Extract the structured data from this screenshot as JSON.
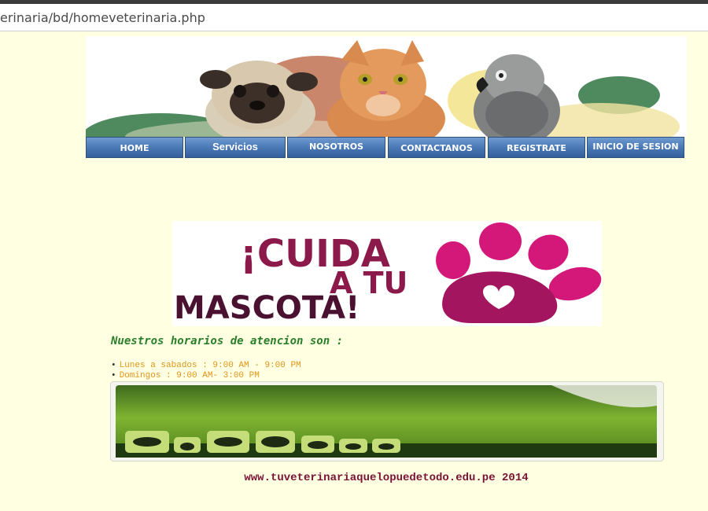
{
  "browser": {
    "url": "erinaria/bd/homeveterinaria.php"
  },
  "nav": {
    "items": [
      {
        "label": "HOME"
      },
      {
        "label": "Servicios"
      },
      {
        "label": "NOSOTROS"
      },
      {
        "label": "CONTACTANOS"
      },
      {
        "label": "REGISTRATE"
      },
      {
        "label": "INICIO DE SESION"
      }
    ]
  },
  "promo": {
    "line1": "¡CUIDA",
    "line2": "A TU",
    "line3": "MASCOTA!"
  },
  "horarios": {
    "title": "Nuestros horarios de atencion son :",
    "items": [
      "Lunes a sabados : 9:00 AM - 9:00 PM",
      "Domingos : 9:00 AM- 3:00 PM"
    ]
  },
  "footer": {
    "text": "www.tuveterinariaquelopuedetodo.edu.pe 2014"
  },
  "colors": {
    "page_bg": "#ffffe1",
    "nav_blue": "#4a79b6",
    "promo_maroon": "#8b1a4a",
    "promo_pink": "#d4187a",
    "horarios_title": "#2a7f2a",
    "horarios_items": "#e0951c",
    "footer": "#7a1236"
  },
  "icons": [
    "pug-photo",
    "cat-photo",
    "parrot-photo",
    "paw-icon",
    "grass-photo",
    "animal-silhouette-icons"
  ]
}
